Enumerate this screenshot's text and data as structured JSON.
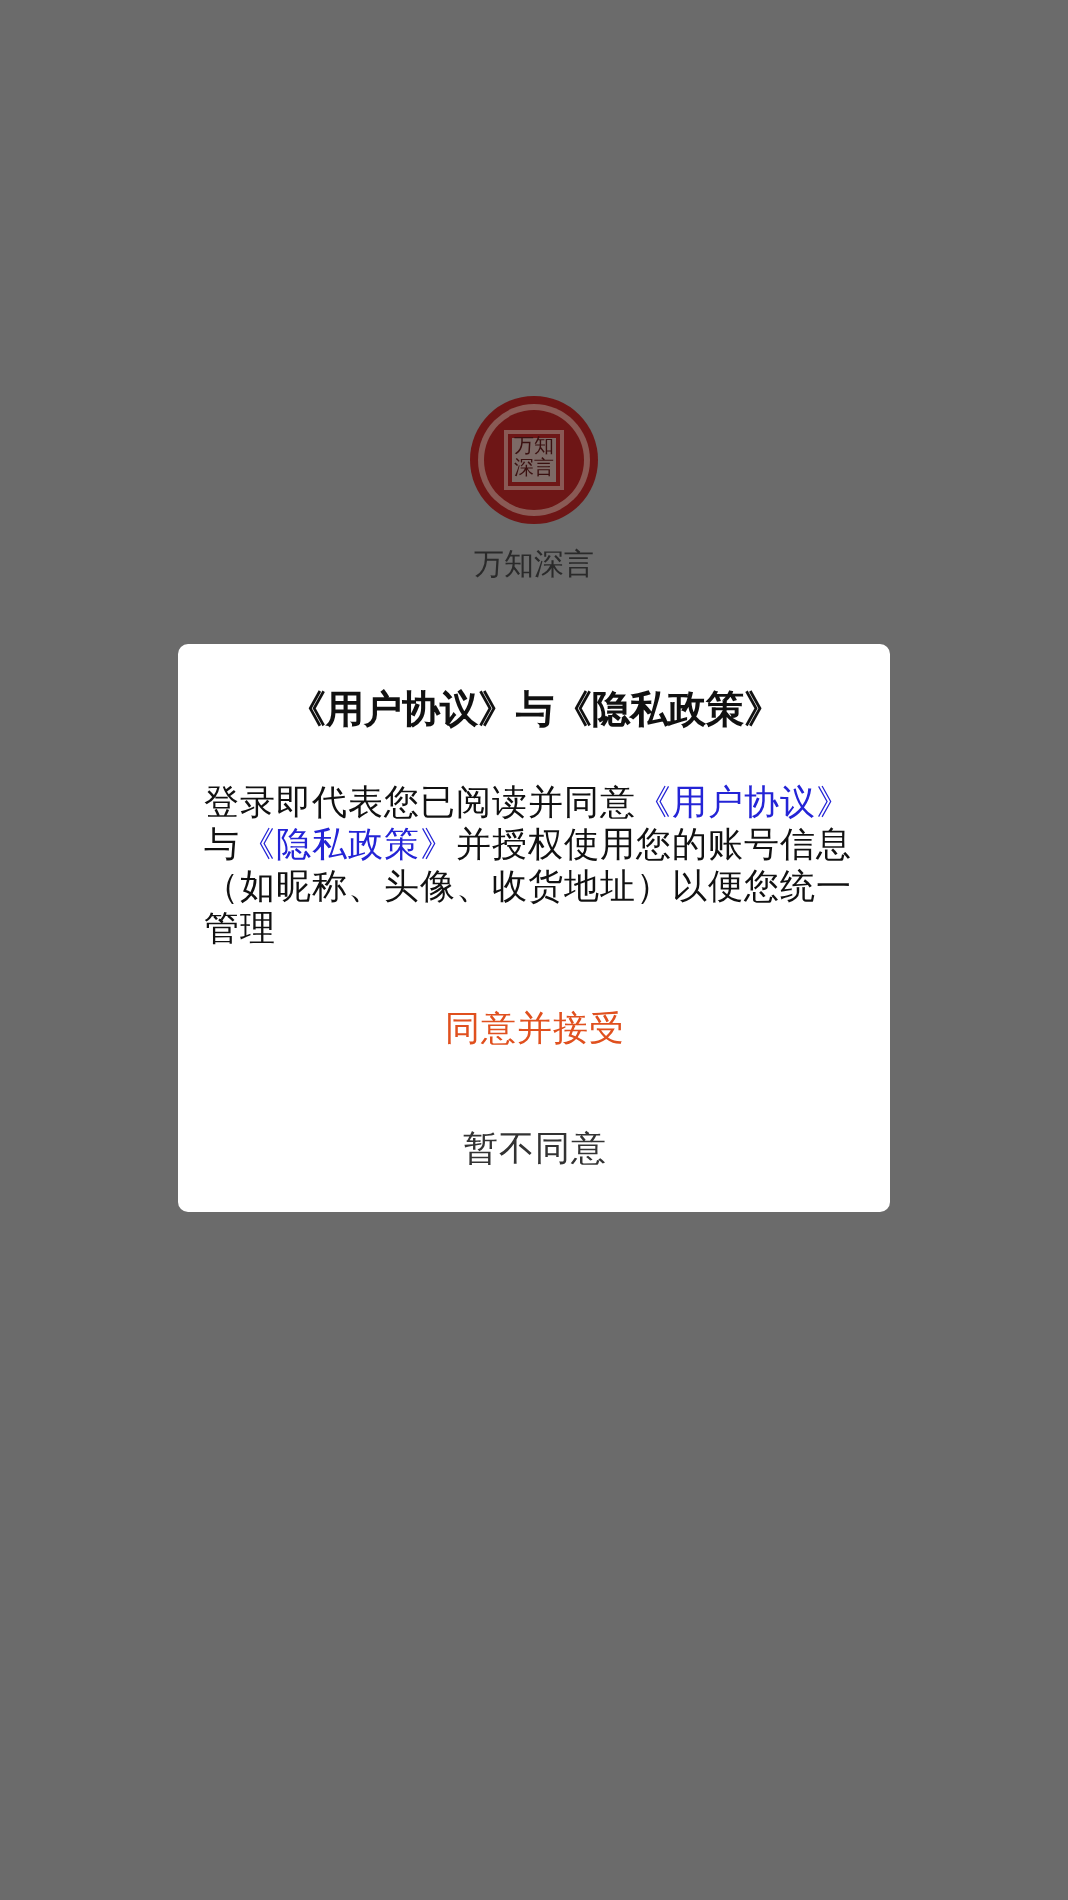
{
  "app": {
    "logo_text": "万知深言",
    "name": "万知深言"
  },
  "dialog": {
    "title": "《用户协议》与《隐私政策》",
    "message": [
      {
        "kind": "text",
        "text": "登录即代表您已阅读并同意"
      },
      {
        "kind": "link",
        "text": "《用户协议》"
      },
      {
        "kind": "text",
        "text": "与"
      },
      {
        "kind": "link",
        "text": "《隐私政策》"
      },
      {
        "kind": "text",
        "text": "并授权使用您的账号信息（如昵称、头像、收货地址）以便您统一管理"
      }
    ],
    "buttons": [
      {
        "label": "同意并接受",
        "kind": "primary"
      },
      {
        "label": "暂不同意",
        "kind": "secondary"
      }
    ]
  }
}
